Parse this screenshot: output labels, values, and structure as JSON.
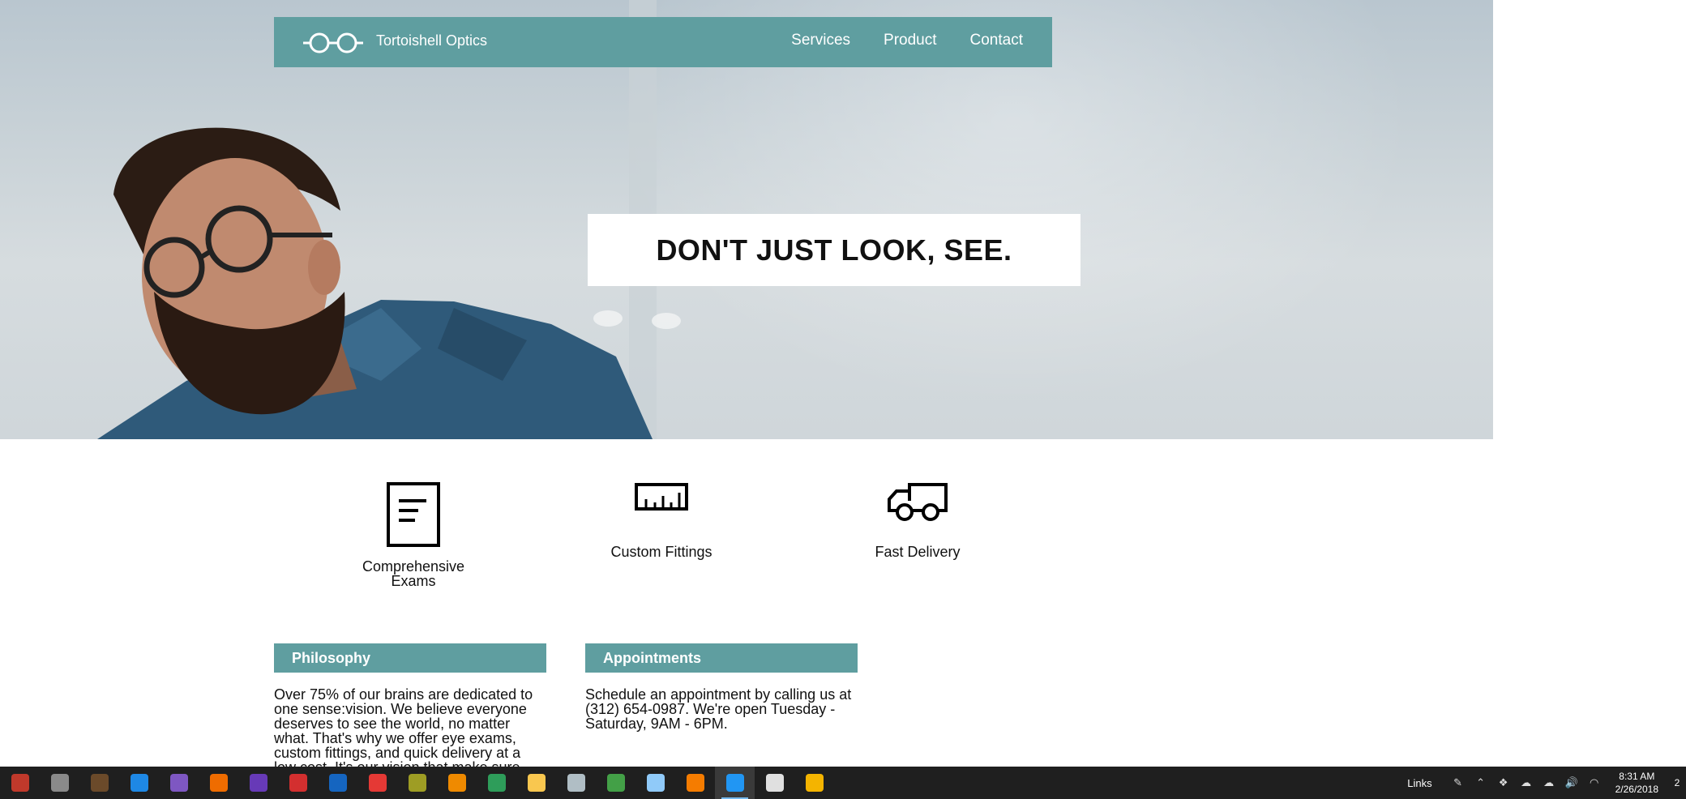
{
  "brand": {
    "name": "Tortoishell Optics",
    "logo_icon": "glasses-icon"
  },
  "nav": {
    "items": [
      "Services",
      "Product",
      "Contact"
    ]
  },
  "hero": {
    "tagline": "DON'T JUST LOOK, SEE."
  },
  "features": [
    {
      "label": "Comprehensive Exams",
      "icon": "document-icon"
    },
    {
      "label": "Custom Fittings",
      "icon": "ruler-icon"
    },
    {
      "label": "Fast Delivery",
      "icon": "truck-icon"
    }
  ],
  "panels": {
    "philosophy": {
      "title": "Philosophy",
      "body": "Over 75% of our brains are dedicated to one sense:vision. We believe everyone deserves to see the world, no matter what. That's why we offer eye exams, custom fittings, and quick delivery at a low cost. It's our vision that make sure"
    },
    "appointments": {
      "title": "Appointments",
      "body": "Schedule an appointment by calling us at (312) 654-0987. We're open Tuesday - Saturday, 9AM - 6PM."
    }
  },
  "taskbar": {
    "apps": [
      {
        "icon": "app-red-icon",
        "color": "#c0392b"
      },
      {
        "icon": "cortana-icon",
        "color": "#8a8a8a"
      },
      {
        "icon": "app-icon",
        "color": "#6b4a2a"
      },
      {
        "icon": "edge-icon",
        "color": "#1e88e5"
      },
      {
        "icon": "visual-studio-icon",
        "color": "#7e57c2"
      },
      {
        "icon": "firefox-icon",
        "color": "#ef6c00"
      },
      {
        "icon": "visual-studio-icon",
        "color": "#673ab7"
      },
      {
        "icon": "app-red-icon",
        "color": "#d32f2f"
      },
      {
        "icon": "outlook-icon",
        "color": "#1565c0"
      },
      {
        "icon": "opera-icon",
        "color": "#e53935"
      },
      {
        "icon": "tools-icon",
        "color": "#9e9d24"
      },
      {
        "icon": "settings-icon",
        "color": "#ef8a00"
      },
      {
        "icon": "app-green-icon",
        "color": "#2e9d5a"
      },
      {
        "icon": "folder-icon",
        "color": "#f9c74f"
      },
      {
        "icon": "app-icon",
        "color": "#b0bec5"
      },
      {
        "icon": "chrome-icon",
        "color": "#43a047"
      },
      {
        "icon": "box-icon",
        "color": "#90caf9"
      },
      {
        "icon": "firefox-icon",
        "color": "#f57c00"
      },
      {
        "icon": "vscode-icon",
        "color": "#2196f3",
        "active": true
      },
      {
        "icon": "app-icon",
        "color": "#e0e0e0"
      },
      {
        "icon": "git-icon",
        "color": "#f4b400"
      }
    ],
    "links_label": "Links",
    "time": "8:31 AM",
    "date": "2/26/2018",
    "notification_count": "2"
  }
}
